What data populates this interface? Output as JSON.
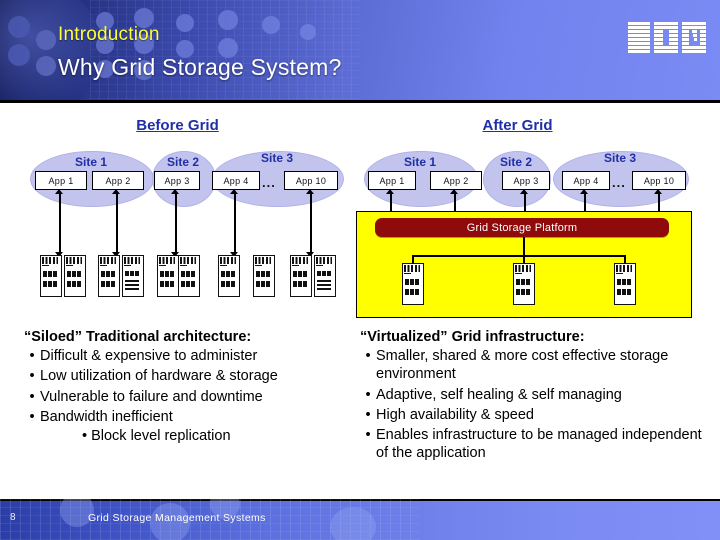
{
  "header": {
    "eyebrow": "Introduction",
    "title": "Why Grid Storage System?",
    "logo_alt": "IBM",
    "eyebrow_color": "#ffff33",
    "title_color": "#ffffff"
  },
  "diagram": {
    "before": {
      "heading": "Before Grid",
      "sites": [
        {
          "label": "Site 1",
          "apps": [
            "App 1",
            "App 2"
          ]
        },
        {
          "label": "Site 2",
          "apps": [
            "App 3"
          ]
        },
        {
          "label": "Site 3",
          "apps": [
            "App 4",
            "App 10"
          ],
          "ellipsis": "..."
        }
      ]
    },
    "after": {
      "heading": "After Grid",
      "sites": [
        {
          "label": "Site 1",
          "apps": [
            "App 1",
            "App 2"
          ]
        },
        {
          "label": "Site 2",
          "apps": [
            "App 3"
          ]
        },
        {
          "label": "Site 3",
          "apps": [
            "App 4",
            "App 10"
          ],
          "ellipsis": "..."
        }
      ],
      "platform_label": "Grid Storage Platform",
      "platform_color": "#8f0b0b",
      "box_color": "#ffff00"
    }
  },
  "left_column": {
    "heading": "“Siloed” Traditional architecture:",
    "bullets": [
      "Difficult & expensive to administer",
      "Low utilization of hardware & storage",
      "Vulnerable to failure and downtime",
      "Bandwidth inefficient"
    ],
    "sub_bullet": "• Block level replication",
    "bullet_glyph": "•"
  },
  "right_column": {
    "heading": "“Virtualized” Grid infrastructure:",
    "bullets": [
      "Smaller, shared & more cost effective storage environment",
      "Adaptive, self healing & self managing",
      "High availability & speed",
      "Enables infrastructure to be managed independent of the application"
    ],
    "bullet_glyph": "•"
  },
  "footer": {
    "slide_number": "8",
    "deck_title": "Grid Storage Management Systems"
  }
}
